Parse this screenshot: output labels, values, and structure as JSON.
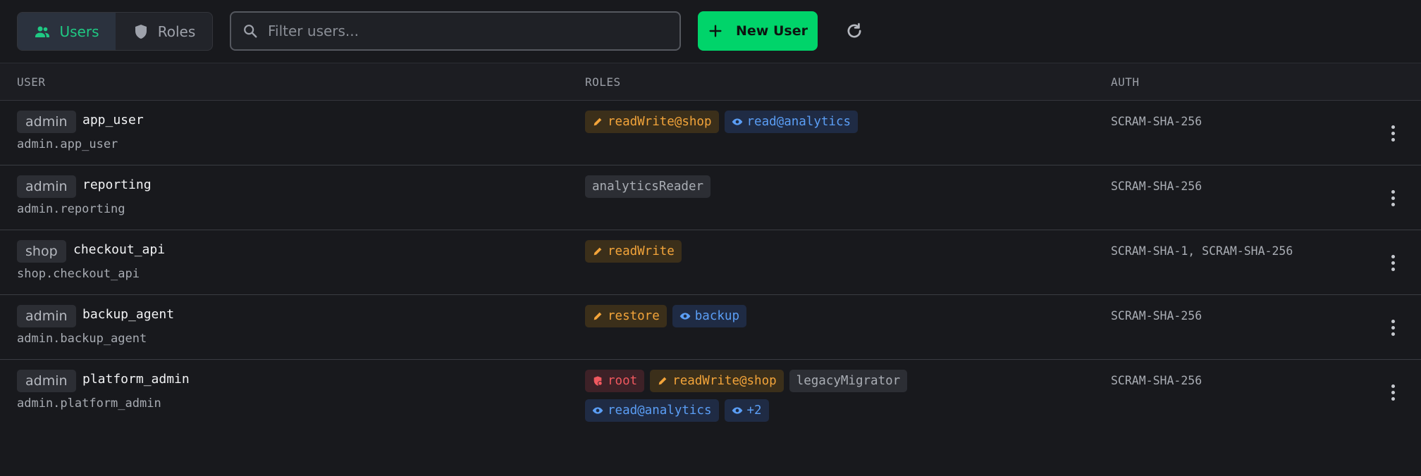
{
  "toolbar": {
    "tabs": [
      {
        "label": "Users",
        "icon": "users-icon",
        "active": true
      },
      {
        "label": "Roles",
        "icon": "shield-icon",
        "active": false
      }
    ],
    "search": {
      "placeholder": "Filter users...",
      "value": ""
    },
    "new_user_label": "New User",
    "refresh_icon": "refresh-icon"
  },
  "table": {
    "columns": [
      "USER",
      "ROLES",
      "AUTH"
    ],
    "rows": [
      {
        "db": "admin",
        "name": "app_user",
        "full": "admin.app_user",
        "roles": [
          {
            "label": "readWrite@shop",
            "kind": "write"
          },
          {
            "label": "read@analytics",
            "kind": "read"
          }
        ],
        "auth": "SCRAM-SHA-256"
      },
      {
        "db": "admin",
        "name": "reporting",
        "full": "admin.reporting",
        "roles": [
          {
            "label": "analyticsReader",
            "kind": "neutral"
          }
        ],
        "auth": "SCRAM-SHA-256"
      },
      {
        "db": "shop",
        "name": "checkout_api",
        "full": "shop.checkout_api",
        "roles": [
          {
            "label": "readWrite",
            "kind": "write"
          }
        ],
        "auth": "SCRAM-SHA-1, SCRAM-SHA-256"
      },
      {
        "db": "admin",
        "name": "backup_agent",
        "full": "admin.backup_agent",
        "roles": [
          {
            "label": "restore",
            "kind": "write"
          },
          {
            "label": "backup",
            "kind": "read"
          }
        ],
        "auth": "SCRAM-SHA-256"
      },
      {
        "db": "admin",
        "name": "platform_admin",
        "full": "admin.platform_admin",
        "roles": [
          {
            "label": "root",
            "kind": "root"
          },
          {
            "label": "readWrite@shop",
            "kind": "write"
          },
          {
            "label": "legacyMigrator",
            "kind": "neutral"
          },
          {
            "label": "read@analytics",
            "kind": "read"
          },
          {
            "label": "+2",
            "kind": "read"
          }
        ],
        "auth": "SCRAM-SHA-256"
      }
    ]
  },
  "colors": {
    "accent_green": "#00d46a",
    "active_tab_text": "#1fc983",
    "write_role": "#f3a43a",
    "read_role": "#5b9ef5",
    "root_role": "#f0585f",
    "background": "#18191d"
  }
}
